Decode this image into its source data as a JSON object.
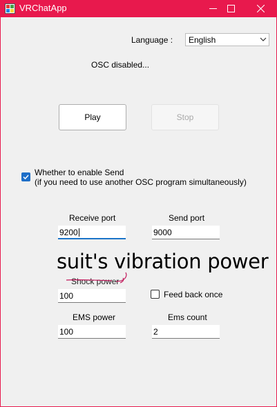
{
  "window": {
    "title": "VRChatApp",
    "accent": "#e8194d",
    "controls": [
      "minimize-icon",
      "maximize-icon",
      "close-icon"
    ]
  },
  "language": {
    "label": "Language :",
    "selected": "English"
  },
  "status": "OSC disabled...",
  "buttons": {
    "play": "Play",
    "stop": "Stop"
  },
  "enable_send": {
    "line1": "Whether to enable Send",
    "line2": "(if you need to use another OSC program simultaneously)",
    "checked": true
  },
  "ports": {
    "receive_label": "Receive port",
    "receive_value": "9200",
    "send_label": "Send port",
    "send_value": "9000"
  },
  "annotation": "suit's vibration power",
  "shock": {
    "label": "Shock power",
    "value": "100"
  },
  "feedback": {
    "label": "Feed back once",
    "checked": false
  },
  "ems": {
    "power_label": "EMS power",
    "power_value": "100",
    "count_label": "Ems count",
    "count_value": "2"
  }
}
